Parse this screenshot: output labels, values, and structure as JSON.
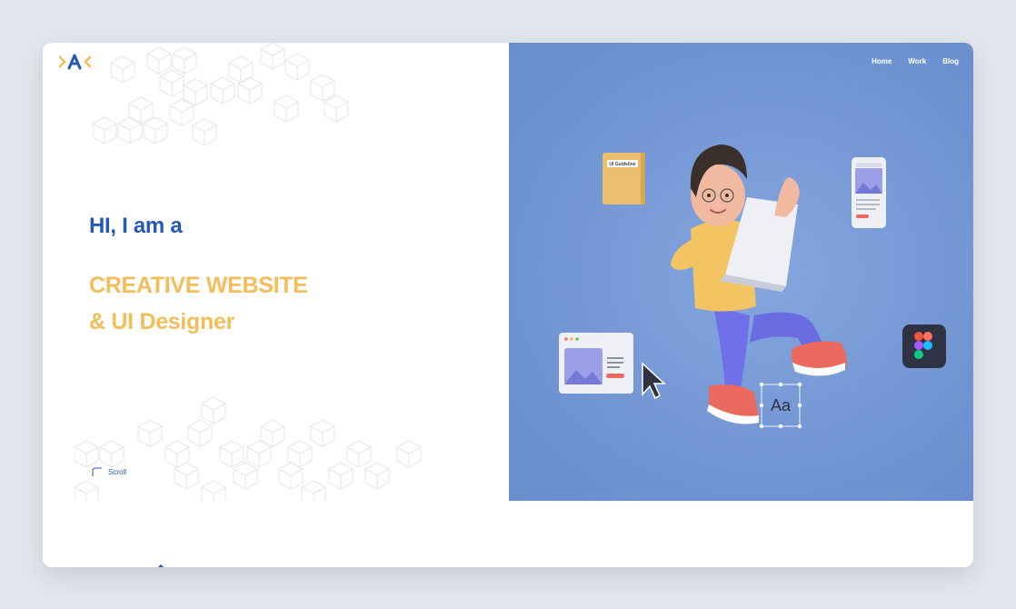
{
  "nav": {
    "links": [
      "Home",
      "Work",
      "Blog"
    ]
  },
  "hero": {
    "greeting": "HI, I am a",
    "title_line1": "CREATIVE WEBSITE",
    "title_line2": "& UI Designer"
  },
  "scroll": {
    "label": "Scroll"
  },
  "illustration": {
    "book_label": "UI Guideline",
    "font_sample": "Aa"
  },
  "colors": {
    "brand_blue": "#2558b8",
    "accent_yellow": "#f4bd59",
    "hero_bg": "#7398d6"
  },
  "icons": [
    "logo-icon",
    "scroll-arrow-icon",
    "cursor-icon",
    "figma-icon"
  ]
}
